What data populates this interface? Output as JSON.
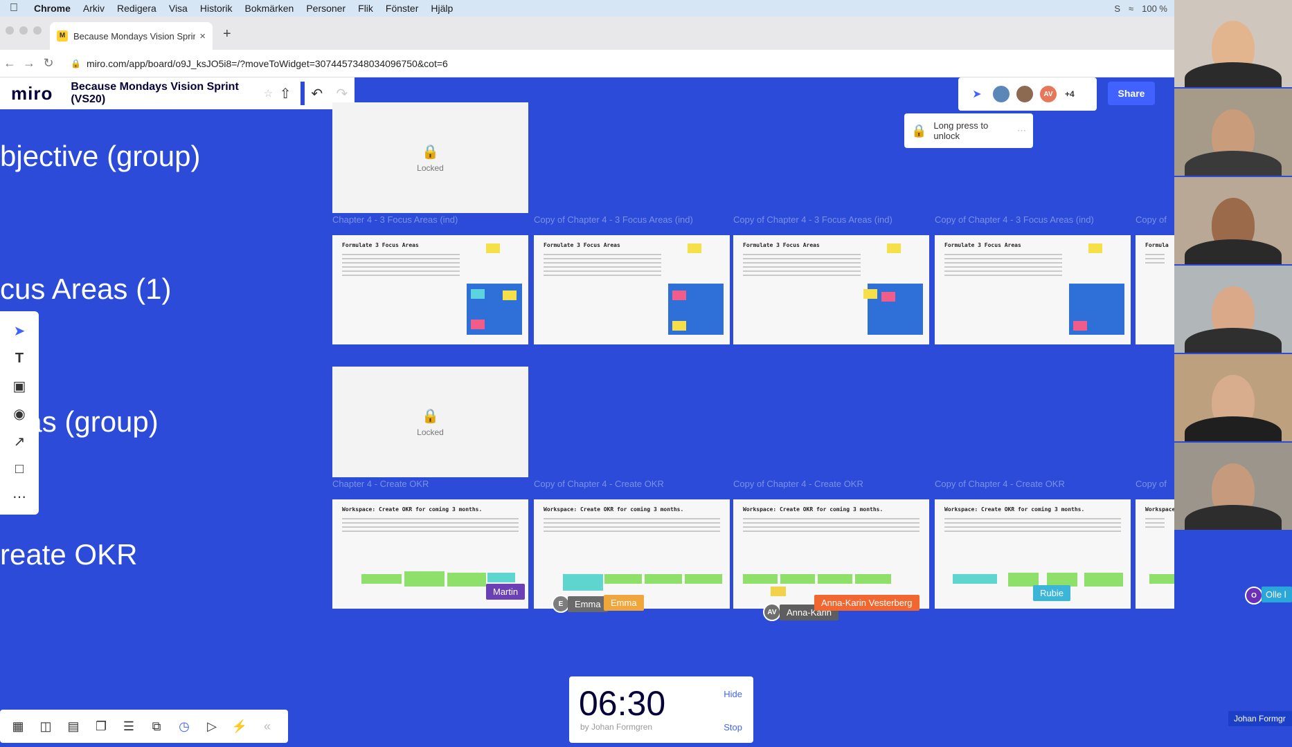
{
  "menubar": {
    "apple": "",
    "items": [
      "Chrome",
      "Arkiv",
      "Redigera",
      "Visa",
      "Historik",
      "Bokmärken",
      "Personer",
      "Flik",
      "Fönster",
      "Hjälp"
    ],
    "battery": "100 %"
  },
  "browser": {
    "tab_title": "Because Mondays Vision Sprir",
    "tab_close": "×",
    "new_tab": "+",
    "url": "miro.com/app/board/o9J_ksJO5i8=/?moveToWidget=3074457348034096750&cot=6"
  },
  "miro": {
    "logo": "miro",
    "board_title": "Because Mondays Vision Sprint (VS20)",
    "share_label": "Share",
    "collab_extra": "+4",
    "avatar_initials": "AV",
    "unlock_text": "Long press to unlock"
  },
  "frame_labels": [
    "bjective (group)",
    "cus Areas (1)",
    "reas (group)",
    "reate OKR"
  ],
  "locked_label": "Locked",
  "row1_titles": [
    "Chapter 4 - 3 Focus Areas (ind)",
    "Copy of Chapter 4 - 3 Focus Areas (ind)",
    "Copy of Chapter 4 - 3 Focus Areas (ind)",
    "Copy of Chapter 4 - 3 Focus Areas (ind)",
    "Copy of"
  ],
  "row1_slide_heading": "Formulate 3 Focus Areas",
  "row1_slide_heading_cut": "Formula",
  "row2_titles": [
    "Chapter 4 - Create OKR",
    "Copy of Chapter 4 - Create OKR",
    "Copy of Chapter 4 - Create OKR",
    "Copy of Chapter 4 - Create OKR",
    "Copy of"
  ],
  "row2_slide_heading": "Workspace: Create OKR for coming 3 months.",
  "row2_slide_heading_cut": "Workspace",
  "cursors": {
    "martin": "Martin",
    "emma_a": "Emma",
    "emma_b": "Emma",
    "annakarin_a": "Anna-Karin",
    "annakarin_b": "Anna-Karin Vesterberg",
    "rubie": "Rubie",
    "olle": "Olle l",
    "emma_initial": "E",
    "annakarin_initials": "AV",
    "olle_initial": "O"
  },
  "timer": {
    "time": "06:30",
    "by": "by Johan Formgren",
    "hide": "Hide",
    "stop": "Stop"
  },
  "video": {
    "self_name": "Johan Formgr"
  }
}
